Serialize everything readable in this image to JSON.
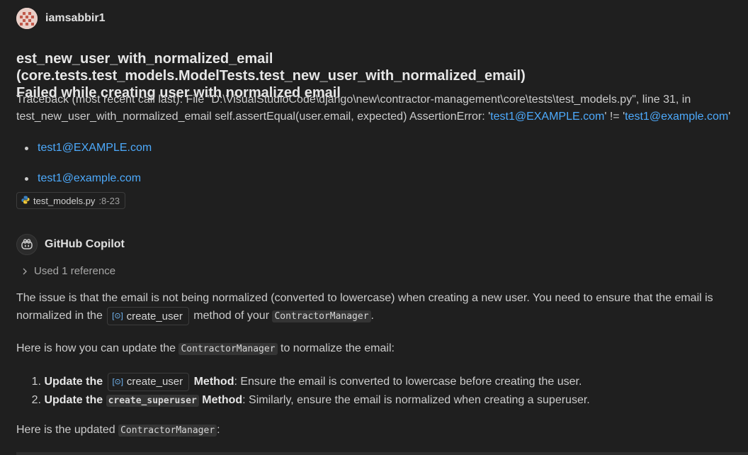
{
  "user": {
    "name": "iamsabbir1"
  },
  "message": {
    "title_line1": "est_new_user_with_normalized_email (core.tests.test_models.ModelTests.test_new_user_with_normalized_email)",
    "title_line2": "Failed while creating user with normalized email",
    "traceback_pre": "Traceback (most recent call last): File \"D:\\VisualStudioCode\\django\\new\\contractor-management\\core\\tests\\test_models.py\", line 31, in test_new_user_with_normalized_email self.assertEqual(user.email, expected) AssertionError: '",
    "traceback_link1": "test1@EXAMPLE.com",
    "traceback_mid": "' != '",
    "traceback_link2": "test1@example.com",
    "traceback_post": "'",
    "links": [
      "test1@EXAMPLE.com",
      "test1@example.com"
    ],
    "file_ref": {
      "icon": "python-icon",
      "name": "test_models.py",
      "range": ":8-23"
    }
  },
  "copilot": {
    "name": "GitHub Copilot",
    "references_label": "Used 1 reference",
    "p1_a": "The issue is that the email is not being normalized (converted to lowercase) when creating a new user. You need to ensure that the email is normalized in the ",
    "p1_chip": "create_user",
    "p1_b": " method of your ",
    "p1_code": "ContractorManager",
    "p1_c": ".",
    "p2_a": "Here is how you can update the ",
    "p2_code": "ContractorManager",
    "p2_b": " to normalize the email:",
    "steps": [
      {
        "num": "1.",
        "bold_a": "Update the",
        "symbol": "create_user",
        "bold_b": "Method",
        "rest": ": Ensure the email is converted to lowercase before creating the user."
      },
      {
        "num": "2.",
        "bold_a": "Update the",
        "code": "create_superuser",
        "bold_b": "Method",
        "rest": ": Similarly, ensure the email is normalized when creating a superuser."
      }
    ],
    "p3_a": "Here is the updated ",
    "p3_code": "ContractorManager",
    "p3_b": ":"
  },
  "colors": {
    "background": "#1f1f1f",
    "link": "#4daafc",
    "text": "#cccccc"
  }
}
